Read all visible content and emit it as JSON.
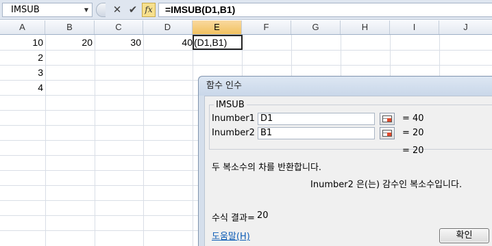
{
  "formula_bar": {
    "name_box": "IMSUB",
    "cancel_glyph": "✕",
    "enter_glyph": "✔",
    "fx_label": "fx",
    "formula": "=IMSUB(D1,B1)"
  },
  "columns": [
    "A",
    "B",
    "C",
    "D",
    "E",
    "F",
    "G",
    "H",
    "I",
    "J"
  ],
  "selected_column": "E",
  "cells": {
    "A1": "10",
    "B1": "20",
    "C1": "30",
    "D1": "40",
    "E1": "(D1,B1)",
    "A2": "2",
    "A3": "3",
    "A4": "4"
  },
  "dialog": {
    "title": "함수 인수",
    "function_name": "IMSUB",
    "args": [
      {
        "label": "Inumber1",
        "value": "D1",
        "result": "=  40"
      },
      {
        "label": "Inumber2",
        "value": "B1",
        "result": "=  20"
      }
    ],
    "function_result": "=  20",
    "description": "두 복소수의 차를 반환합니다.",
    "arg_help": "Inumber2  은(는) 감수인 복소수입니다.",
    "formula_result_label": "수식 결과=",
    "formula_result_value": "20",
    "help_link": "도움말(H)",
    "ok_label": "확인"
  }
}
